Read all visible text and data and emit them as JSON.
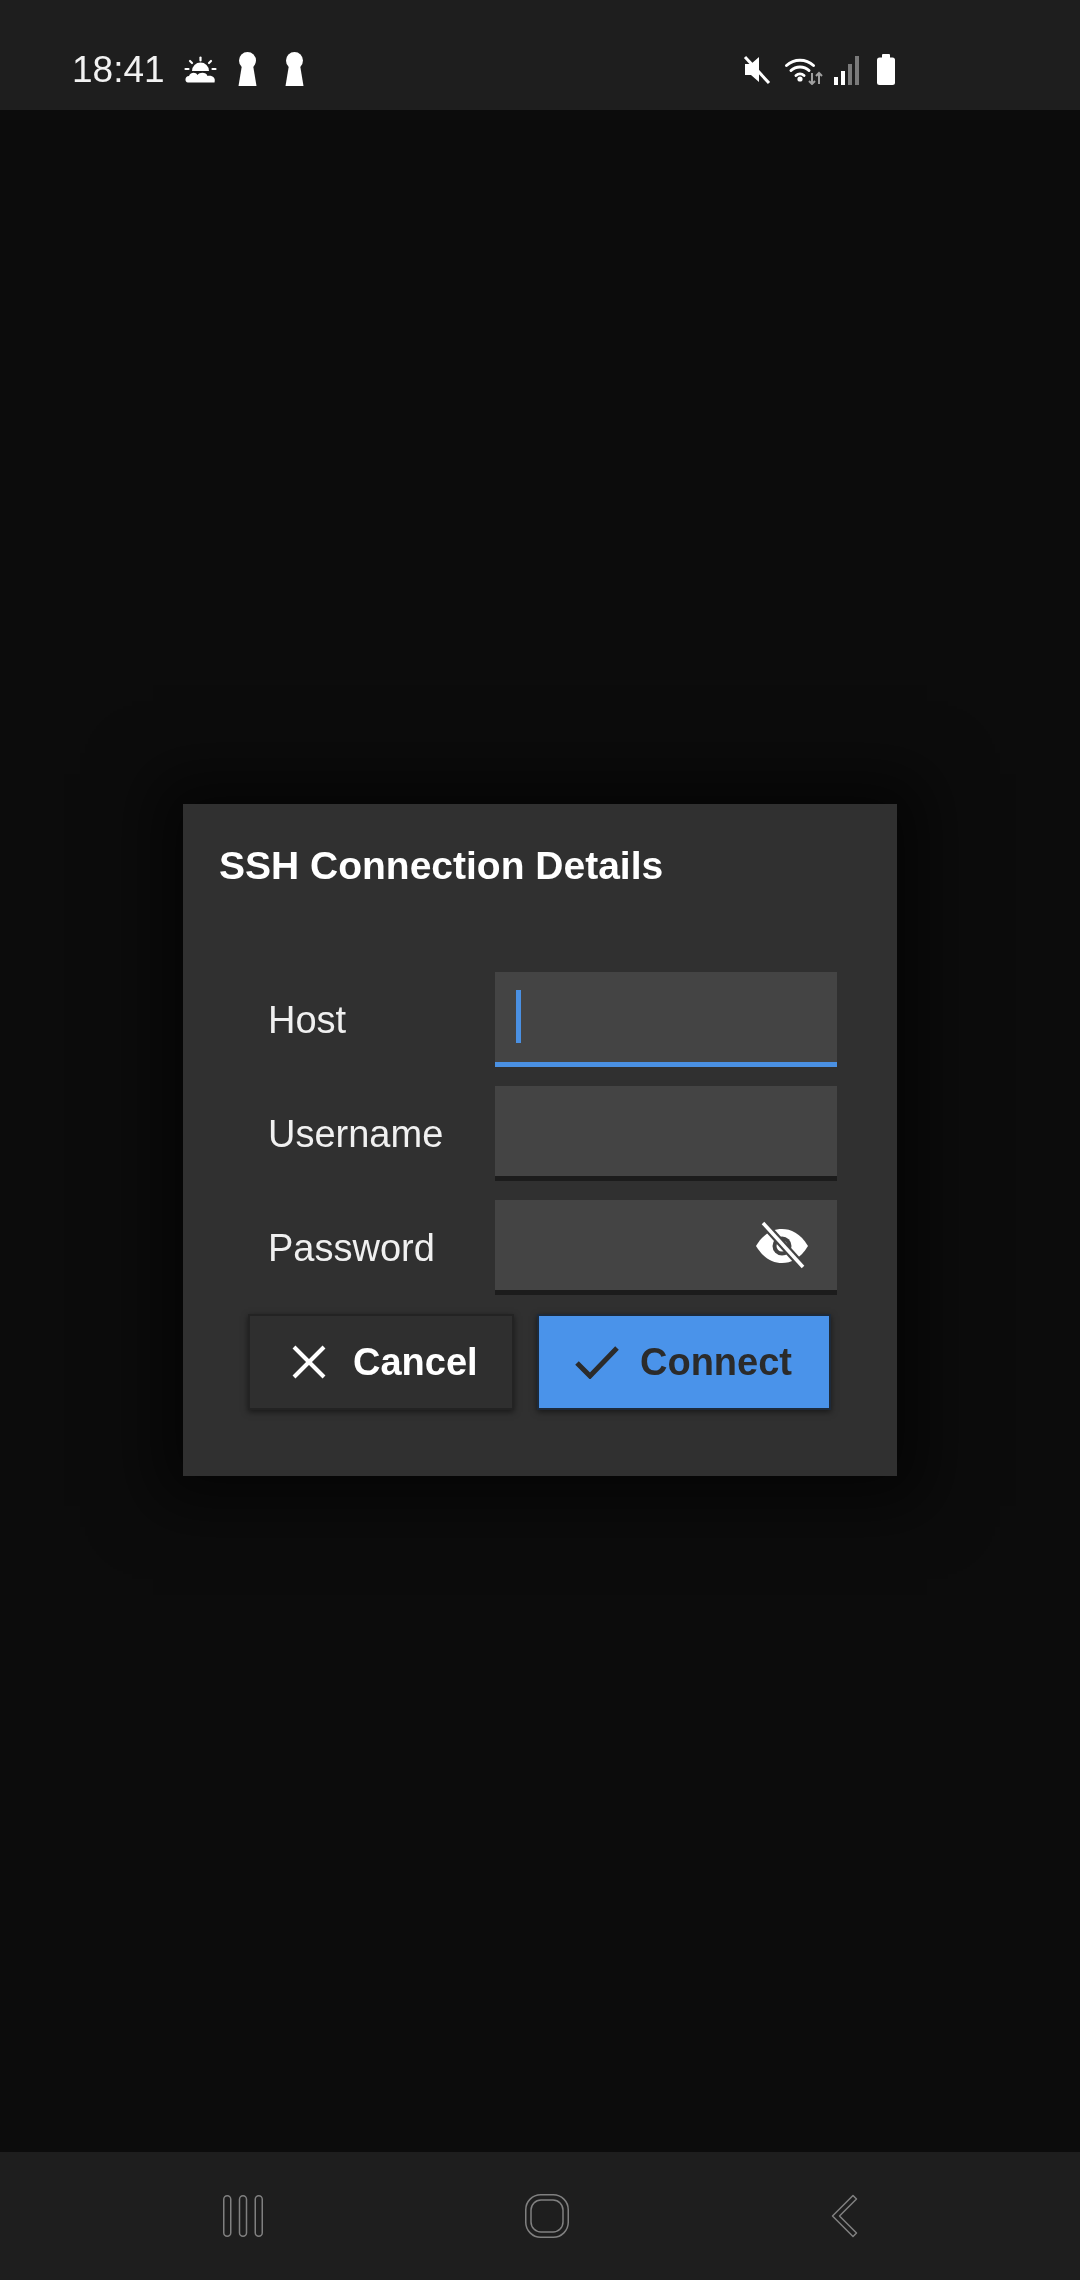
{
  "status_bar": {
    "time": "18:41"
  },
  "dialog": {
    "title": "SSH Connection Details",
    "fields": [
      {
        "label": "Host",
        "kind": "text",
        "focused": true
      },
      {
        "label": "Username",
        "kind": "text",
        "focused": false
      },
      {
        "label": "Password",
        "kind": "password",
        "focused": false
      }
    ],
    "buttons": [
      {
        "label": "Cancel",
        "kind": "secondary"
      },
      {
        "label": "Connect",
        "kind": "primary"
      }
    ]
  }
}
